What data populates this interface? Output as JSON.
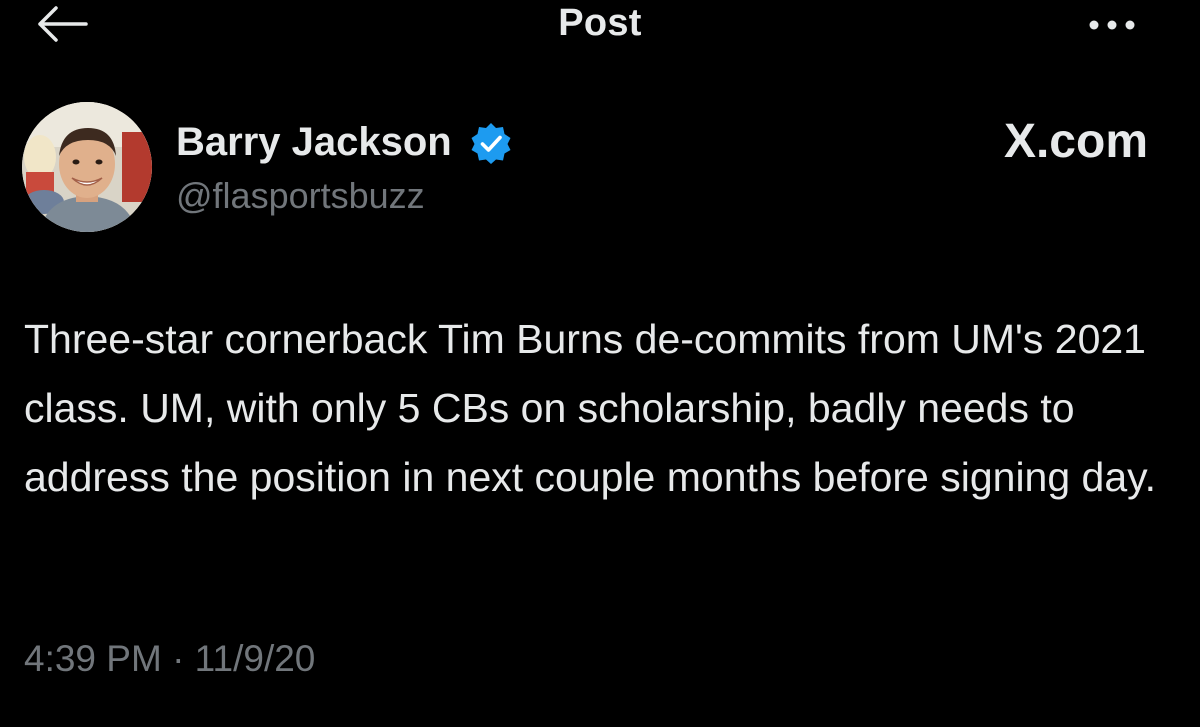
{
  "header": {
    "title": "Post",
    "back_icon": "arrow-left-icon",
    "more_icon": "more-horizontal-icon"
  },
  "author": {
    "name": "Barry Jackson",
    "handle": "@flasportsbuzz",
    "verified_icon": "verified-badge-icon",
    "verified_color": "#1d9bf0"
  },
  "brand": {
    "label": "X.com"
  },
  "post": {
    "text": "Three-star cornerback Tim Burns de-commits from UM's 2021 class. UM, with only 5 CBs on scholarship, badly needs to address the position in next couple months before signing day.",
    "timestamp": "4:39 PM · 11/9/20"
  },
  "colors": {
    "background": "#000000",
    "primary_text": "#e7e9ea",
    "secondary_text": "#71767b"
  }
}
